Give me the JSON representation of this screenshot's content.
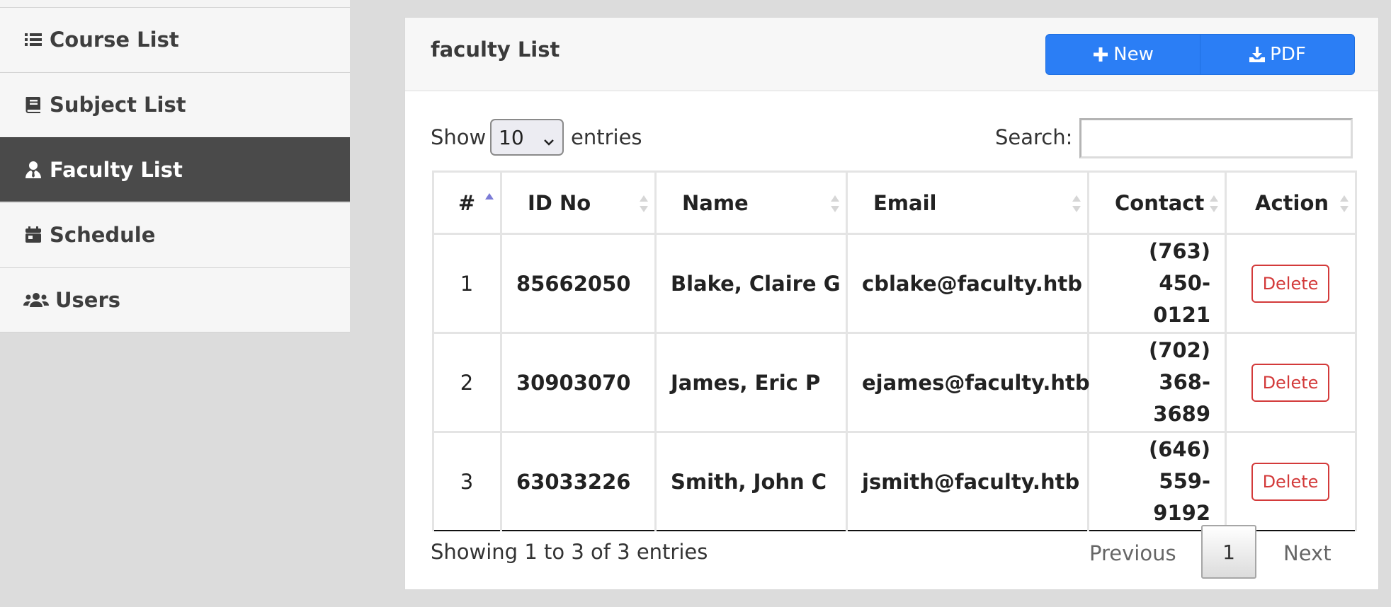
{
  "sidebar": {
    "items": [
      {
        "label": "Course List",
        "icon": "list-icon",
        "active": false
      },
      {
        "label": "Subject List",
        "icon": "book-icon",
        "active": false
      },
      {
        "label": "Faculty List",
        "icon": "user-tie-icon",
        "active": true
      },
      {
        "label": "Schedule",
        "icon": "calendar-icon",
        "active": false
      },
      {
        "label": "Users",
        "icon": "users-icon",
        "active": false
      }
    ]
  },
  "card": {
    "title": "faculty List",
    "new_label": "New",
    "pdf_label": "PDF"
  },
  "controls": {
    "show_label": "Show",
    "entries_value": "10",
    "entries_label": "entries",
    "search_label": "Search:",
    "search_value": ""
  },
  "table": {
    "headers": [
      "#",
      "ID No",
      "Name",
      "Email",
      "Contact",
      "Action"
    ],
    "sorted_column": "#",
    "rows": [
      {
        "num": "1",
        "id": "85662050",
        "name": "Blake, Claire G",
        "email": "cblake@faculty.htb",
        "contact_line1": "(763)",
        "contact_line2": "450-0121",
        "action": "Delete"
      },
      {
        "num": "2",
        "id": "30903070",
        "name": "James, Eric P",
        "email": "ejames@faculty.htb",
        "contact_line1": "(702)",
        "contact_line2": "368-3689",
        "action": "Delete"
      },
      {
        "num": "3",
        "id": "63033226",
        "name": "Smith, John C",
        "email": "jsmith@faculty.htb",
        "contact_line1": "(646)",
        "contact_line2": "559-9192",
        "action": "Delete"
      }
    ]
  },
  "footer": {
    "info": "Showing 1 to 3 of 3 entries",
    "previous": "Previous",
    "current_page": "1",
    "next": "Next"
  },
  "colors": {
    "primary": "#2b7ef5",
    "danger": "#d33a3a",
    "sidebar_active": "#4a4a4a"
  }
}
